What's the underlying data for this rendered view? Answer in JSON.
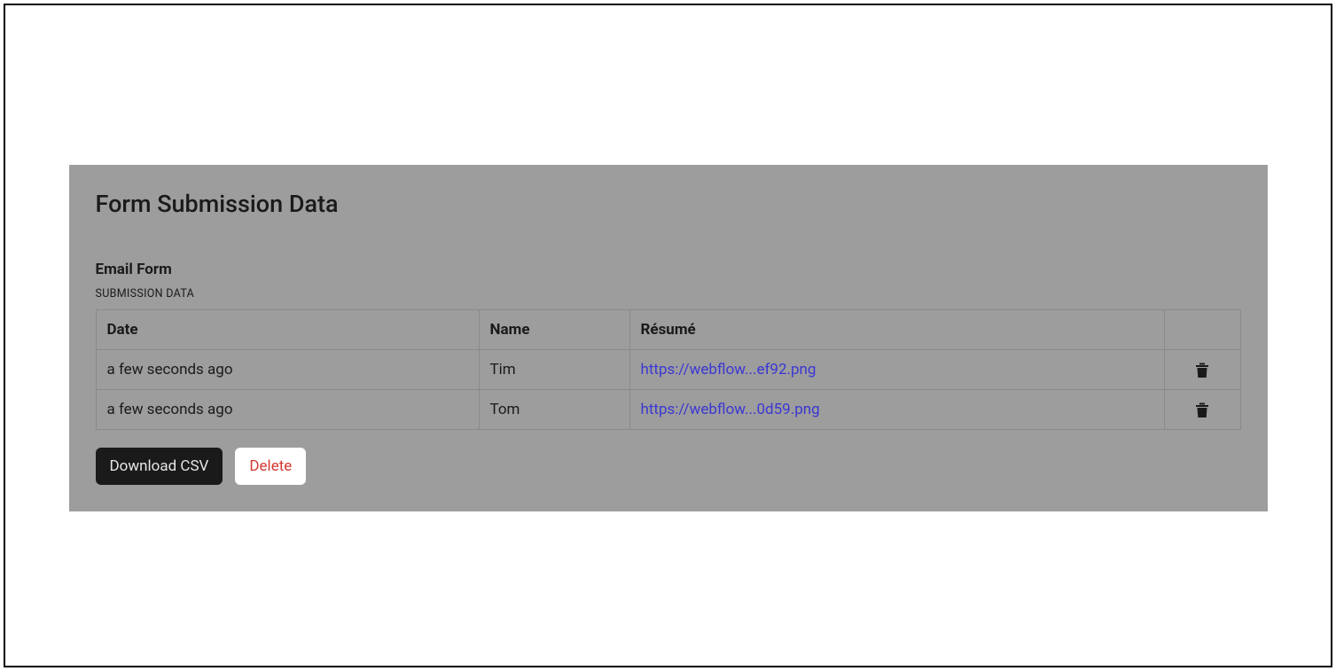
{
  "panel": {
    "title": "Form Submission Data",
    "form_name": "Email Form",
    "sub_label": "SUBMISSION DATA"
  },
  "table": {
    "headers": {
      "date": "Date",
      "name": "Name",
      "resume": "Résumé",
      "action": ""
    },
    "rows": [
      {
        "date": "a few seconds ago",
        "name": "Tim",
        "resume": "https://webflow...ef92.png"
      },
      {
        "date": "a few seconds ago",
        "name": "Tom",
        "resume": "https://webflow...0d59.png"
      }
    ]
  },
  "buttons": {
    "download": "Download CSV",
    "delete": "Delete"
  },
  "icons": {
    "trash": "trash-icon"
  }
}
